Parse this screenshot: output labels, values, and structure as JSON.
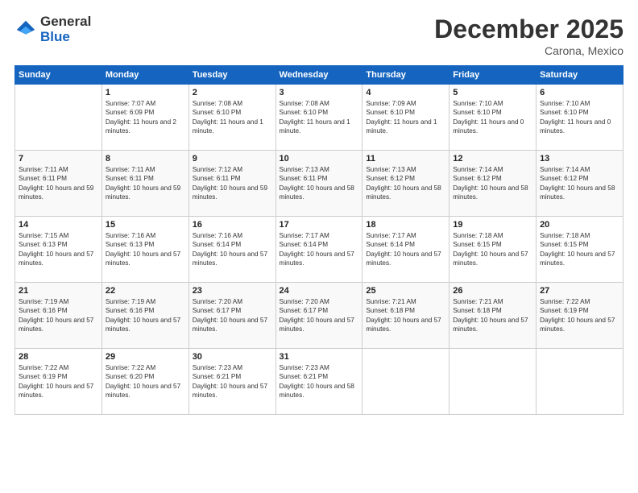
{
  "logo": {
    "general": "General",
    "blue": "Blue"
  },
  "header": {
    "month": "December 2025",
    "location": "Carona, Mexico"
  },
  "days_of_week": [
    "Sunday",
    "Monday",
    "Tuesday",
    "Wednesday",
    "Thursday",
    "Friday",
    "Saturday"
  ],
  "weeks": [
    [
      {
        "day": "",
        "sunrise": "",
        "sunset": "",
        "daylight": ""
      },
      {
        "day": "1",
        "sunrise": "Sunrise: 7:07 AM",
        "sunset": "Sunset: 6:09 PM",
        "daylight": "Daylight: 11 hours and 2 minutes."
      },
      {
        "day": "2",
        "sunrise": "Sunrise: 7:08 AM",
        "sunset": "Sunset: 6:10 PM",
        "daylight": "Daylight: 11 hours and 1 minute."
      },
      {
        "day": "3",
        "sunrise": "Sunrise: 7:08 AM",
        "sunset": "Sunset: 6:10 PM",
        "daylight": "Daylight: 11 hours and 1 minute."
      },
      {
        "day": "4",
        "sunrise": "Sunrise: 7:09 AM",
        "sunset": "Sunset: 6:10 PM",
        "daylight": "Daylight: 11 hours and 1 minute."
      },
      {
        "day": "5",
        "sunrise": "Sunrise: 7:10 AM",
        "sunset": "Sunset: 6:10 PM",
        "daylight": "Daylight: 11 hours and 0 minutes."
      },
      {
        "day": "6",
        "sunrise": "Sunrise: 7:10 AM",
        "sunset": "Sunset: 6:10 PM",
        "daylight": "Daylight: 11 hours and 0 minutes."
      }
    ],
    [
      {
        "day": "7",
        "sunrise": "Sunrise: 7:11 AM",
        "sunset": "Sunset: 6:11 PM",
        "daylight": "Daylight: 10 hours and 59 minutes."
      },
      {
        "day": "8",
        "sunrise": "Sunrise: 7:11 AM",
        "sunset": "Sunset: 6:11 PM",
        "daylight": "Daylight: 10 hours and 59 minutes."
      },
      {
        "day": "9",
        "sunrise": "Sunrise: 7:12 AM",
        "sunset": "Sunset: 6:11 PM",
        "daylight": "Daylight: 10 hours and 59 minutes."
      },
      {
        "day": "10",
        "sunrise": "Sunrise: 7:13 AM",
        "sunset": "Sunset: 6:11 PM",
        "daylight": "Daylight: 10 hours and 58 minutes."
      },
      {
        "day": "11",
        "sunrise": "Sunrise: 7:13 AM",
        "sunset": "Sunset: 6:12 PM",
        "daylight": "Daylight: 10 hours and 58 minutes."
      },
      {
        "day": "12",
        "sunrise": "Sunrise: 7:14 AM",
        "sunset": "Sunset: 6:12 PM",
        "daylight": "Daylight: 10 hours and 58 minutes."
      },
      {
        "day": "13",
        "sunrise": "Sunrise: 7:14 AM",
        "sunset": "Sunset: 6:12 PM",
        "daylight": "Daylight: 10 hours and 58 minutes."
      }
    ],
    [
      {
        "day": "14",
        "sunrise": "Sunrise: 7:15 AM",
        "sunset": "Sunset: 6:13 PM",
        "daylight": "Daylight: 10 hours and 57 minutes."
      },
      {
        "day": "15",
        "sunrise": "Sunrise: 7:16 AM",
        "sunset": "Sunset: 6:13 PM",
        "daylight": "Daylight: 10 hours and 57 minutes."
      },
      {
        "day": "16",
        "sunrise": "Sunrise: 7:16 AM",
        "sunset": "Sunset: 6:14 PM",
        "daylight": "Daylight: 10 hours and 57 minutes."
      },
      {
        "day": "17",
        "sunrise": "Sunrise: 7:17 AM",
        "sunset": "Sunset: 6:14 PM",
        "daylight": "Daylight: 10 hours and 57 minutes."
      },
      {
        "day": "18",
        "sunrise": "Sunrise: 7:17 AM",
        "sunset": "Sunset: 6:14 PM",
        "daylight": "Daylight: 10 hours and 57 minutes."
      },
      {
        "day": "19",
        "sunrise": "Sunrise: 7:18 AM",
        "sunset": "Sunset: 6:15 PM",
        "daylight": "Daylight: 10 hours and 57 minutes."
      },
      {
        "day": "20",
        "sunrise": "Sunrise: 7:18 AM",
        "sunset": "Sunset: 6:15 PM",
        "daylight": "Daylight: 10 hours and 57 minutes."
      }
    ],
    [
      {
        "day": "21",
        "sunrise": "Sunrise: 7:19 AM",
        "sunset": "Sunset: 6:16 PM",
        "daylight": "Daylight: 10 hours and 57 minutes."
      },
      {
        "day": "22",
        "sunrise": "Sunrise: 7:19 AM",
        "sunset": "Sunset: 6:16 PM",
        "daylight": "Daylight: 10 hours and 57 minutes."
      },
      {
        "day": "23",
        "sunrise": "Sunrise: 7:20 AM",
        "sunset": "Sunset: 6:17 PM",
        "daylight": "Daylight: 10 hours and 57 minutes."
      },
      {
        "day": "24",
        "sunrise": "Sunrise: 7:20 AM",
        "sunset": "Sunset: 6:17 PM",
        "daylight": "Daylight: 10 hours and 57 minutes."
      },
      {
        "day": "25",
        "sunrise": "Sunrise: 7:21 AM",
        "sunset": "Sunset: 6:18 PM",
        "daylight": "Daylight: 10 hours and 57 minutes."
      },
      {
        "day": "26",
        "sunrise": "Sunrise: 7:21 AM",
        "sunset": "Sunset: 6:18 PM",
        "daylight": "Daylight: 10 hours and 57 minutes."
      },
      {
        "day": "27",
        "sunrise": "Sunrise: 7:22 AM",
        "sunset": "Sunset: 6:19 PM",
        "daylight": "Daylight: 10 hours and 57 minutes."
      }
    ],
    [
      {
        "day": "28",
        "sunrise": "Sunrise: 7:22 AM",
        "sunset": "Sunset: 6:19 PM",
        "daylight": "Daylight: 10 hours and 57 minutes."
      },
      {
        "day": "29",
        "sunrise": "Sunrise: 7:22 AM",
        "sunset": "Sunset: 6:20 PM",
        "daylight": "Daylight: 10 hours and 57 minutes."
      },
      {
        "day": "30",
        "sunrise": "Sunrise: 7:23 AM",
        "sunset": "Sunset: 6:21 PM",
        "daylight": "Daylight: 10 hours and 57 minutes."
      },
      {
        "day": "31",
        "sunrise": "Sunrise: 7:23 AM",
        "sunset": "Sunset: 6:21 PM",
        "daylight": "Daylight: 10 hours and 58 minutes."
      },
      {
        "day": "",
        "sunrise": "",
        "sunset": "",
        "daylight": ""
      },
      {
        "day": "",
        "sunrise": "",
        "sunset": "",
        "daylight": ""
      },
      {
        "day": "",
        "sunrise": "",
        "sunset": "",
        "daylight": ""
      }
    ]
  ]
}
